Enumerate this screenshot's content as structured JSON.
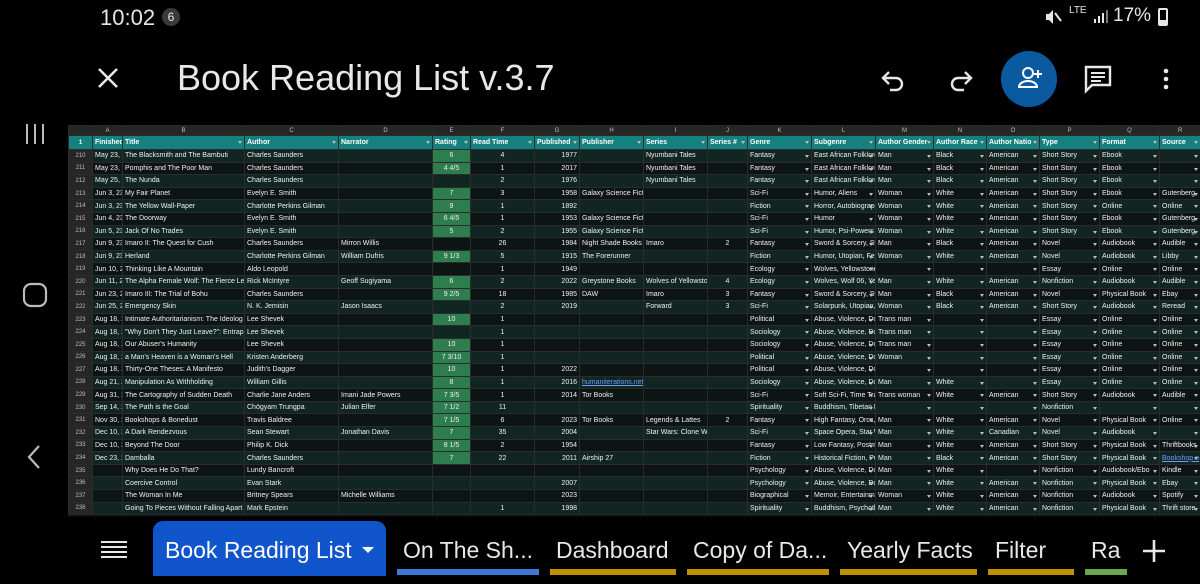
{
  "status_bar": {
    "time": "10:02",
    "notification_count": "6",
    "network": "LTE",
    "battery": "17%"
  },
  "toolbar": {
    "title": "Book Reading List v.3.7"
  },
  "columns": [
    "A",
    "B",
    "C",
    "D",
    "E",
    "F",
    "G",
    "H",
    "I",
    "J",
    "K",
    "L",
    "M",
    "N",
    "O",
    "P",
    "Q",
    "R"
  ],
  "headers": [
    "Finished",
    "Title",
    "Author",
    "Narrator",
    "Rating",
    "Read Time",
    "Published",
    "Publisher",
    "Series",
    "Series #",
    "Genre",
    "Subgenre",
    "Author Gender",
    "Author Race",
    "Author Natio",
    "Type",
    "Format",
    "Source"
  ],
  "rows": [
    {
      "n": "210",
      "a": "May 23, 23",
      "b": "The Blacksmith and The Bambuti",
      "c": "Charles Saunders",
      "d": "",
      "e": "6",
      "f": "4",
      "g": "1977",
      "h": "",
      "i": "Nyumbani Tales",
      "j": "",
      "k": "Fantasy",
      "l": "East African Folklore",
      "m": "Man",
      "o": "Black",
      "p": "American",
      "q": "Short Story",
      "r": "Ebook",
      "s": ""
    },
    {
      "n": "211",
      "a": "May 23, 23",
      "b": "Pomphis and The Poor Man",
      "c": "Charles Saunders",
      "d": "",
      "e": "4 4/5",
      "f": "1",
      "g": "2017",
      "h": "",
      "i": "Nyumbani Tales",
      "j": "",
      "k": "Fantasy",
      "l": "East African Folklore",
      "m": "Man",
      "o": "Black",
      "p": "American",
      "q": "Short Story",
      "r": "Ebook",
      "s": ""
    },
    {
      "n": "212",
      "a": "May 25, 23",
      "b": "The Nunda",
      "c": "Charles Saunders",
      "d": "",
      "e": "",
      "f": "2",
      "g": "1976",
      "h": "",
      "i": "Nyumbani Tales",
      "j": "",
      "k": "Fantasy",
      "l": "East African Folklore",
      "m": "Man",
      "o": "Black",
      "p": "American",
      "q": "Short Story",
      "r": "Ebook",
      "s": ""
    },
    {
      "n": "213",
      "a": "Jun 3, 23",
      "b": "My Fair Planet",
      "c": "Evelyn E. Smith",
      "d": "",
      "e": "7",
      "f": "3",
      "g": "1958",
      "h": "Galaxy Science Fiction",
      "i": "",
      "j": "",
      "k": "Sci-Fi",
      "l": "Humor, Aliens",
      "m": "Woman",
      "o": "White",
      "p": "American",
      "q": "Short Story",
      "r": "Ebook",
      "s": "Gutenberg"
    },
    {
      "n": "214",
      "a": "Jun 3, 23",
      "b": "The Yellow Wall-Paper",
      "c": "Charlotte Perkins Gilman",
      "d": "",
      "e": "9",
      "f": "1",
      "g": "1892",
      "h": "",
      "i": "",
      "j": "",
      "k": "Fiction",
      "l": "Horror, Autobiograp",
      "m": "Woman",
      "o": "White",
      "p": "American",
      "q": "Short Story",
      "r": "Online",
      "s": "Online"
    },
    {
      "n": "215",
      "a": "Jun 4, 23",
      "b": "The Doorway",
      "c": "Evelyn E. Smith",
      "d": "",
      "e": "6 4/5",
      "f": "1",
      "g": "1953",
      "h": "Galaxy Science Fiction",
      "i": "",
      "j": "",
      "k": "Sci-Fi",
      "l": "Humor",
      "m": "Woman",
      "o": "White",
      "p": "American",
      "q": "Short Story",
      "r": "Ebook",
      "s": "Gutenberg"
    },
    {
      "n": "216",
      "a": "Jun 5, 23",
      "b": "Jack Of No Trades",
      "c": "Evelyn E. Smith",
      "d": "",
      "e": "5",
      "f": "2",
      "g": "1955",
      "h": "Galaxy Science Fiction",
      "i": "",
      "j": "",
      "k": "Sci-Fi",
      "l": "Humor, Psi-Powers",
      "m": "Woman",
      "o": "White",
      "p": "American",
      "q": "Short Story",
      "r": "Ebook",
      "s": "Gutenberg"
    },
    {
      "n": "217",
      "a": "Jun 9, 23",
      "b": "Imaro II: The Quest for Cush",
      "c": "Charles Saunders",
      "d": "Mirron Willis",
      "e": "",
      "f": "26",
      "g": "1984",
      "h": "Night Shade Books",
      "i": "Imaro",
      "j": "2",
      "k": "Fantasy",
      "l": "Sword & Sorcery, Sw",
      "m": "Man",
      "o": "Black",
      "p": "American",
      "q": "Novel",
      "r": "Audiobook",
      "s": "Audible"
    },
    {
      "n": "218",
      "a": "Jun 9, 23",
      "b": "Herland",
      "c": "Charlotte Perkins Gilman",
      "d": "William Dufris",
      "e": "9 1/3",
      "f": "5",
      "g": "1915",
      "h": "The Forerunner",
      "i": "",
      "j": "",
      "k": "Fiction",
      "l": "Humor, Utopian, Fer",
      "m": "Woman",
      "o": "White",
      "p": "American",
      "q": "Novel",
      "r": "Audiobook",
      "s": "Libby"
    },
    {
      "n": "219",
      "a": "Jun 10, 23",
      "b": "Thinking Like A Mountain",
      "c": "Aldo Leopold",
      "d": "",
      "e": "",
      "f": "1",
      "g": "1949",
      "h": "",
      "i": "",
      "j": "",
      "k": "Ecology",
      "l": "Wolves, Yellowstone",
      "m": "",
      "o": "",
      "p": "",
      "q": "Essay",
      "r": "Online",
      "s": "Online"
    },
    {
      "n": "220",
      "a": "Jun 11, 23",
      "b": "The Alpha Female Wolf: The Fierce Leg",
      "c": "Rick McIntyre",
      "d": "Geoff Sugiyama",
      "e": "6",
      "f": "2",
      "g": "2022",
      "h": "Greystone Books",
      "i": "Wolves of Yellowsto",
      "j": "4",
      "k": "Ecology",
      "l": "Wolves, Wolf 06, Ye",
      "m": "Man",
      "o": "White",
      "p": "American",
      "q": "Nonfiction",
      "r": "Audiobook",
      "s": "Audible"
    },
    {
      "n": "221",
      "a": "Jun 23, 23",
      "b": "Imaro III: The Trial of Bohu",
      "c": "Charles Saunders",
      "d": "",
      "e": "9 2/5",
      "f": "18",
      "g": "1985",
      "h": "DAW",
      "i": "Imaro",
      "j": "3",
      "k": "Fantasy",
      "l": "Sword & Sorcery, Sw",
      "m": "Man",
      "o": "Black",
      "p": "American",
      "q": "Novel",
      "r": "Physical Book",
      "s": "Ebay"
    },
    {
      "n": "222",
      "a": "Jun 25, 23",
      "b": "Emergency Skin",
      "c": "N. K. Jemisin",
      "d": "Jason Isaacs",
      "e": "",
      "f": "2",
      "g": "2019",
      "h": "",
      "i": "Forward",
      "j": "3",
      "k": "Sci-Fi",
      "l": "Solarpunk, Utopian,",
      "m": "Woman",
      "o": "Black",
      "p": "American",
      "q": "Short Story",
      "r": "Audiobook",
      "s": "Reread"
    },
    {
      "n": "223",
      "a": "Aug 18, 23",
      "b": "Intimate Authoritarianism: The Ideolog",
      "c": "Lee Shevek",
      "d": "",
      "e": "10",
      "f": "1",
      "g": "",
      "h": "",
      "i": "",
      "j": "",
      "k": "Political",
      "l": "Abuse, Violence, Dc",
      "m": "Trans man",
      "o": "",
      "p": "",
      "q": "Essay",
      "r": "Online",
      "s": "Online"
    },
    {
      "n": "224",
      "a": "Aug 18, 23",
      "b": "\"Why Don't They Just Leave?\": Entrapm",
      "c": "Lee Shevek",
      "d": "",
      "e": "",
      "f": "1",
      "g": "",
      "h": "",
      "i": "",
      "j": "",
      "k": "Sociology",
      "l": "Abuse, Violence, Dc",
      "m": "Trans man",
      "o": "",
      "p": "",
      "q": "Essay",
      "r": "Online",
      "s": "Online"
    },
    {
      "n": "225",
      "a": "Aug 18, 23",
      "b": "Our Abuser's Humanity",
      "c": "Lee Shevek",
      "d": "",
      "e": "10",
      "f": "1",
      "g": "",
      "h": "",
      "i": "",
      "j": "",
      "k": "Sociology",
      "l": "Abuse, Violence, Dc",
      "m": "Trans man",
      "o": "",
      "p": "",
      "q": "Essay",
      "r": "Online",
      "s": "Online"
    },
    {
      "n": "226",
      "a": "Aug 18, 23",
      "b": "a Man's Heaven is a Woman's Hell",
      "c": "Kristen Anderberg",
      "d": "",
      "e": "7 3/10",
      "f": "1",
      "g": "",
      "h": "",
      "i": "",
      "j": "",
      "k": "Political",
      "l": "Abuse, Violence, Dc",
      "m": "Woman",
      "o": "",
      "p": "",
      "q": "Essay",
      "r": "Online",
      "s": "Online"
    },
    {
      "n": "227",
      "a": "Aug 18, 23",
      "b": "Thirty-One Theses: A Manifesto",
      "c": "Judith's Dagger",
      "d": "",
      "e": "10",
      "f": "1",
      "g": "2022",
      "h": "",
      "i": "",
      "j": "",
      "k": "Political",
      "l": "Abuse, Violence, Dc",
      "m": "",
      "o": "",
      "p": "",
      "q": "Essay",
      "r": "Online",
      "s": "Online"
    },
    {
      "n": "228",
      "a": "Aug 21, 23",
      "b": "Manipulation As Withholding",
      "c": "William Gillis",
      "d": "",
      "e": "8",
      "f": "1",
      "g": "2016",
      "h": "humaniterations.net",
      "i": "",
      "j": "",
      "k": "Sociology",
      "l": "Abuse, Violence, Dc",
      "m": "Man",
      "o": "White",
      "p": "",
      "q": "Essay",
      "r": "Online",
      "s": "Online"
    },
    {
      "n": "229",
      "a": "Aug 31, 23",
      "b": "The Cartography of Sudden Death",
      "c": "Charlie Jane Anders",
      "d": "Imani Jade Powers",
      "e": "7 3/5",
      "f": "1",
      "g": "2014",
      "h": "Tor Books",
      "i": "",
      "j": "",
      "k": "Sci-Fi",
      "l": "Soft Sci-Fi, Time Tra",
      "m": "Trans woman",
      "o": "White",
      "p": "American",
      "q": "Short Story",
      "r": "Audiobook",
      "s": "Audible"
    },
    {
      "n": "230",
      "a": "Sep 14, 23",
      "b": "The Path is the Goal",
      "c": "Chögyam Trungpa",
      "d": "Julian Elfer",
      "e": "7 1/2",
      "f": "11",
      "g": "",
      "h": "",
      "i": "",
      "j": "",
      "k": "Spirituality",
      "l": "Buddhism, Tibetan E",
      "m": "",
      "o": "",
      "p": "",
      "q": "Nonfiction",
      "r": "",
      "s": ""
    },
    {
      "n": "231",
      "a": "Nov 30, 23",
      "b": "Bookshops & Bonedust",
      "c": "Travis Baldree",
      "d": "",
      "e": "7 1/5",
      "f": "6",
      "g": "2023",
      "h": "Tor Books",
      "i": "Legends & Lattes",
      "j": "2",
      "k": "Fantasy",
      "l": "High Fantasy, Orcs,",
      "m": "Man",
      "o": "White",
      "p": "American",
      "q": "Novel",
      "r": "Physical Book",
      "s": "Online"
    },
    {
      "n": "232",
      "a": "Dec 10, 23",
      "b": "A Dark Rendezvous",
      "c": "Sean Stewart",
      "d": "Jonathan Davis",
      "e": "7",
      "f": "35",
      "g": "2004",
      "h": "",
      "i": "Star Wars: Clone Wars",
      "j": "",
      "k": "Sci-Fi",
      "l": "Space Opera, Star W",
      "m": "Man",
      "o": "White",
      "p": "Canadian",
      "q": "Novel",
      "r": "Audiobook",
      "s": ""
    },
    {
      "n": "233",
      "a": "Dec 10, 23",
      "b": "Beyond The Door",
      "c": "Philip K. Dick",
      "d": "",
      "e": "8 1/5",
      "f": "2",
      "g": "1954",
      "h": "",
      "i": "",
      "j": "",
      "k": "Fantasy",
      "l": "Low Fantasy, Postme",
      "m": "Man",
      "o": "White",
      "p": "American",
      "q": "Short Story",
      "r": "Physical Book",
      "s": "Thriftbooks"
    },
    {
      "n": "234",
      "a": "Dec 23, 23",
      "b": "Damballa",
      "c": "Charles Saunders",
      "d": "",
      "e": "7",
      "f": "22",
      "g": "2011",
      "h": "Airship 27",
      "i": "",
      "j": "",
      "k": "Fiction",
      "l": "Historical Fiction, Pu",
      "m": "Man",
      "o": "Black",
      "p": "American",
      "q": "Short Story",
      "r": "Physical Book",
      "s": "Bookshop.o"
    },
    {
      "n": "235",
      "a": "",
      "b": "Why Does He Do That?",
      "c": "Lundy Bancroft",
      "d": "",
      "e": "",
      "f": "",
      "g": "",
      "h": "",
      "i": "",
      "j": "",
      "k": "Psychology",
      "l": "Abuse, Violence, Dc",
      "m": "Man",
      "o": "White",
      "p": "",
      "q": "Nonfiction",
      "r": "Audiobook/Ebo",
      "s": "Kindle"
    },
    {
      "n": "236",
      "a": "",
      "b": "Coercive Control",
      "c": "Evan Stark",
      "d": "",
      "e": "",
      "f": "",
      "g": "2007",
      "h": "",
      "i": "",
      "j": "",
      "k": "Psychology",
      "l": "Abuse, Violence, Dc",
      "m": "Man",
      "o": "White",
      "p": "American",
      "q": "Nonfiction",
      "r": "Physical Book",
      "s": "Ebay"
    },
    {
      "n": "237",
      "a": "",
      "b": "The Woman In Me",
      "c": "Britney Spears",
      "d": "Michelle Williams",
      "e": "",
      "f": "",
      "g": "2023",
      "h": "",
      "i": "",
      "j": "",
      "k": "Biographical",
      "l": "Memoir, Entertainm",
      "m": "Woman",
      "o": "White",
      "p": "American",
      "q": "Nonfiction",
      "r": "Audiobook",
      "s": "Spotify"
    },
    {
      "n": "238",
      "a": "",
      "b": "Going To Pieces Without Falling Apart",
      "c": "Mark Epstein",
      "d": "",
      "e": "",
      "f": "1",
      "g": "1998",
      "h": "",
      "i": "",
      "j": "",
      "k": "Spirituality",
      "l": "Buddhism, Psychoth",
      "m": "Man",
      "o": "White",
      "p": "American",
      "q": "Nonfiction",
      "r": "Physical Book",
      "s": "Thrift store"
    }
  ],
  "sheet_tabs": [
    {
      "label": "Book Reading List",
      "color": "#1155cc"
    },
    {
      "label": "On The Sh...",
      "color": "#3c78d8"
    },
    {
      "label": "Dashboard",
      "color": "#bf9000"
    },
    {
      "label": "Copy of Da...",
      "color": "#bf9000"
    },
    {
      "label": "Yearly Facts",
      "color": "#bf9000"
    },
    {
      "label": "Filter",
      "color": "#bf9000"
    },
    {
      "label": "Ra",
      "color": "#6aa84f"
    }
  ],
  "icons": {
    "close": "close-icon",
    "undo": "undo-icon",
    "redo": "redo-icon",
    "share": "add-person-icon",
    "comments": "comment-icon",
    "more": "more-vert-icon",
    "add": "add-icon",
    "menu": "list-icon"
  }
}
